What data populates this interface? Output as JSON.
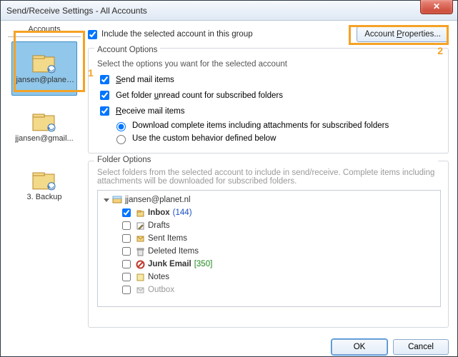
{
  "title": "Send/Receive Settings - All Accounts",
  "accounts_header": "Accounts",
  "accounts": [
    {
      "label": "jjansen@planet...",
      "selected": true
    },
    {
      "label": "jjansen@gmail...",
      "selected": false
    },
    {
      "label": "3. Backup",
      "selected": false
    }
  ],
  "include_label": "Include the selected account in this group",
  "include_checked": true,
  "account_properties_btn": "Account Properties...",
  "annotations": {
    "one": "1",
    "two": "2"
  },
  "account_options": {
    "title": "Account Options",
    "desc": "Select the options you want for the selected account",
    "send_mail": {
      "label": "Send mail items",
      "checked": true
    },
    "unread_count": {
      "label": "Get folder unread count for subscribed folders",
      "checked": true
    },
    "receive_mail": {
      "label": "Receive mail items",
      "checked": true
    },
    "radio_download": "Download complete items including attachments for subscribed folders",
    "radio_custom": "Use the custom behavior defined below",
    "radio_selected": "download"
  },
  "folder_options": {
    "title": "Folder Options",
    "desc": "Select folders from the selected account to include in send/receive. Complete items including attachments will be downloaded for subscribed folders.",
    "root": "jjansen@planet.nl",
    "items": [
      {
        "name": "Inbox",
        "count": "(144)",
        "checked": true,
        "bold": true,
        "count_color": "blue"
      },
      {
        "name": "Drafts",
        "checked": false
      },
      {
        "name": "Sent Items",
        "checked": false
      },
      {
        "name": "Deleted Items",
        "checked": false
      },
      {
        "name": "Junk Email",
        "count": "[350]",
        "checked": false,
        "bold": true,
        "count_color": "green"
      },
      {
        "name": "Notes",
        "checked": false
      },
      {
        "name": "Outbox",
        "checked": false,
        "gray": true
      }
    ]
  },
  "buttons": {
    "ok": "OK",
    "cancel": "Cancel"
  }
}
